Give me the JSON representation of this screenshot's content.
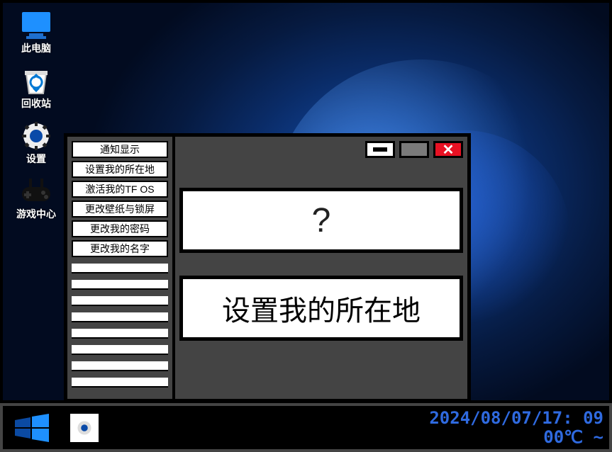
{
  "desktop_icons": [
    {
      "id": "this-pc",
      "label": "此电脑"
    },
    {
      "id": "recycle-bin",
      "label": "回收站"
    },
    {
      "id": "settings",
      "label": "设置"
    },
    {
      "id": "game-center",
      "label": "游戏中心"
    }
  ],
  "settings_window": {
    "sidebar_items": [
      "通知显示",
      "设置我的所在地",
      "激活我的TF OS",
      "更改壁纸与锁屏",
      "更改我的密码",
      "更改我的名字"
    ],
    "question_mark": "?",
    "current_panel_title": "设置我的所在地"
  },
  "taskbar": {
    "datetime_line1": "2024/08/07/17: 09",
    "datetime_line2": "00℃      ~"
  }
}
